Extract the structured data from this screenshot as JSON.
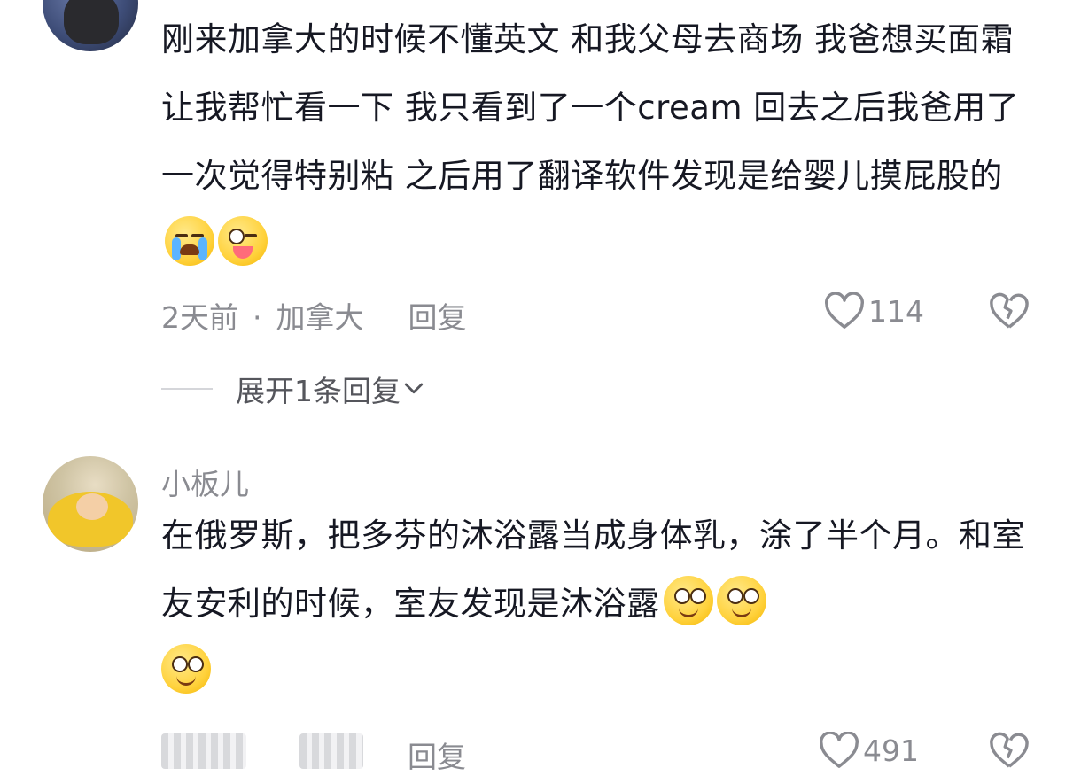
{
  "comments": [
    {
      "text": "刚来加拿大的时候不懂英文 和我父母去商场 我爸想买面霜让我帮忙看一下 我只看到了一个cream 回去之后我爸用了一次觉得特别粘 之后用了翻译软件发现是给婴儿摸屁股的",
      "emojis": [
        "loudly-crying-face-emoji",
        "winking-face-with-tongue-emoji"
      ],
      "time": "2天前",
      "location": "加拿大",
      "reply_label": "回复",
      "likes": "114",
      "expand_label": "展开1条回复"
    },
    {
      "username": "小板儿",
      "text": "在俄罗斯，把多芬的沐浴露当成身体乳，涂了半个月。和室友安利的时候，室友发现是沐浴露",
      "emojis": [
        "dazed-face-emoji",
        "dazed-face-emoji",
        "dazed-face-emoji"
      ],
      "reply_label": "回复",
      "likes": "491"
    }
  ],
  "colors": {
    "text": "#161823",
    "meta": "#8a8b91",
    "divider": "#d5d6da"
  }
}
